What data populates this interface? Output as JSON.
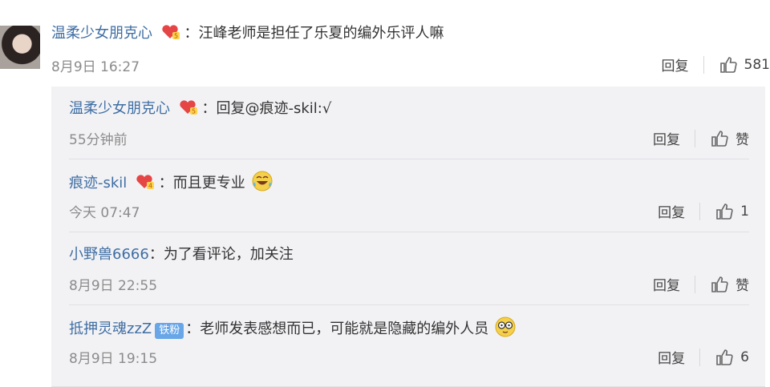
{
  "main": {
    "username": "温柔少女朋克心",
    "separator": "：",
    "text": "汪峰老师是担任了乐夏的编外乐评人嘛",
    "time": "8月9日 16:27",
    "reply_label": "回复",
    "likes": "581"
  },
  "replies": [
    {
      "username": "温柔少女朋克心",
      "separator": "：",
      "text": "回复@痕迹-skil:√",
      "time": "55分钟前",
      "reply_label": "回复",
      "likes": "赞"
    },
    {
      "username": "痕迹-skil",
      "separator": "：",
      "text": "而且更专业",
      "time": "今天 07:47",
      "reply_label": "回复",
      "likes": "1"
    },
    {
      "username": "小野兽6666",
      "separator": "：",
      "text": "为了看评论，加关注",
      "time": "8月9日 22:55",
      "reply_label": "回复",
      "likes": "赞"
    },
    {
      "username": "抵押灵魂zzZ",
      "badge": "铁粉",
      "separator": "：",
      "text": "老师发表感想而已，可能就是隐藏的编外人员",
      "time": "8月9日 19:15",
      "reply_label": "回复",
      "likes": "6"
    }
  ],
  "icons": {
    "vip": "vip-heart-icon",
    "like": "thumbs-up-icon",
    "emoji_laugh": "laughing-tears-emoji-icon",
    "emoji_glasses": "glasses-face-emoji-icon"
  },
  "colors": {
    "username": "#3f6ea3",
    "reply_bg": "#f2f2f5",
    "badge": "#68a6e8"
  }
}
